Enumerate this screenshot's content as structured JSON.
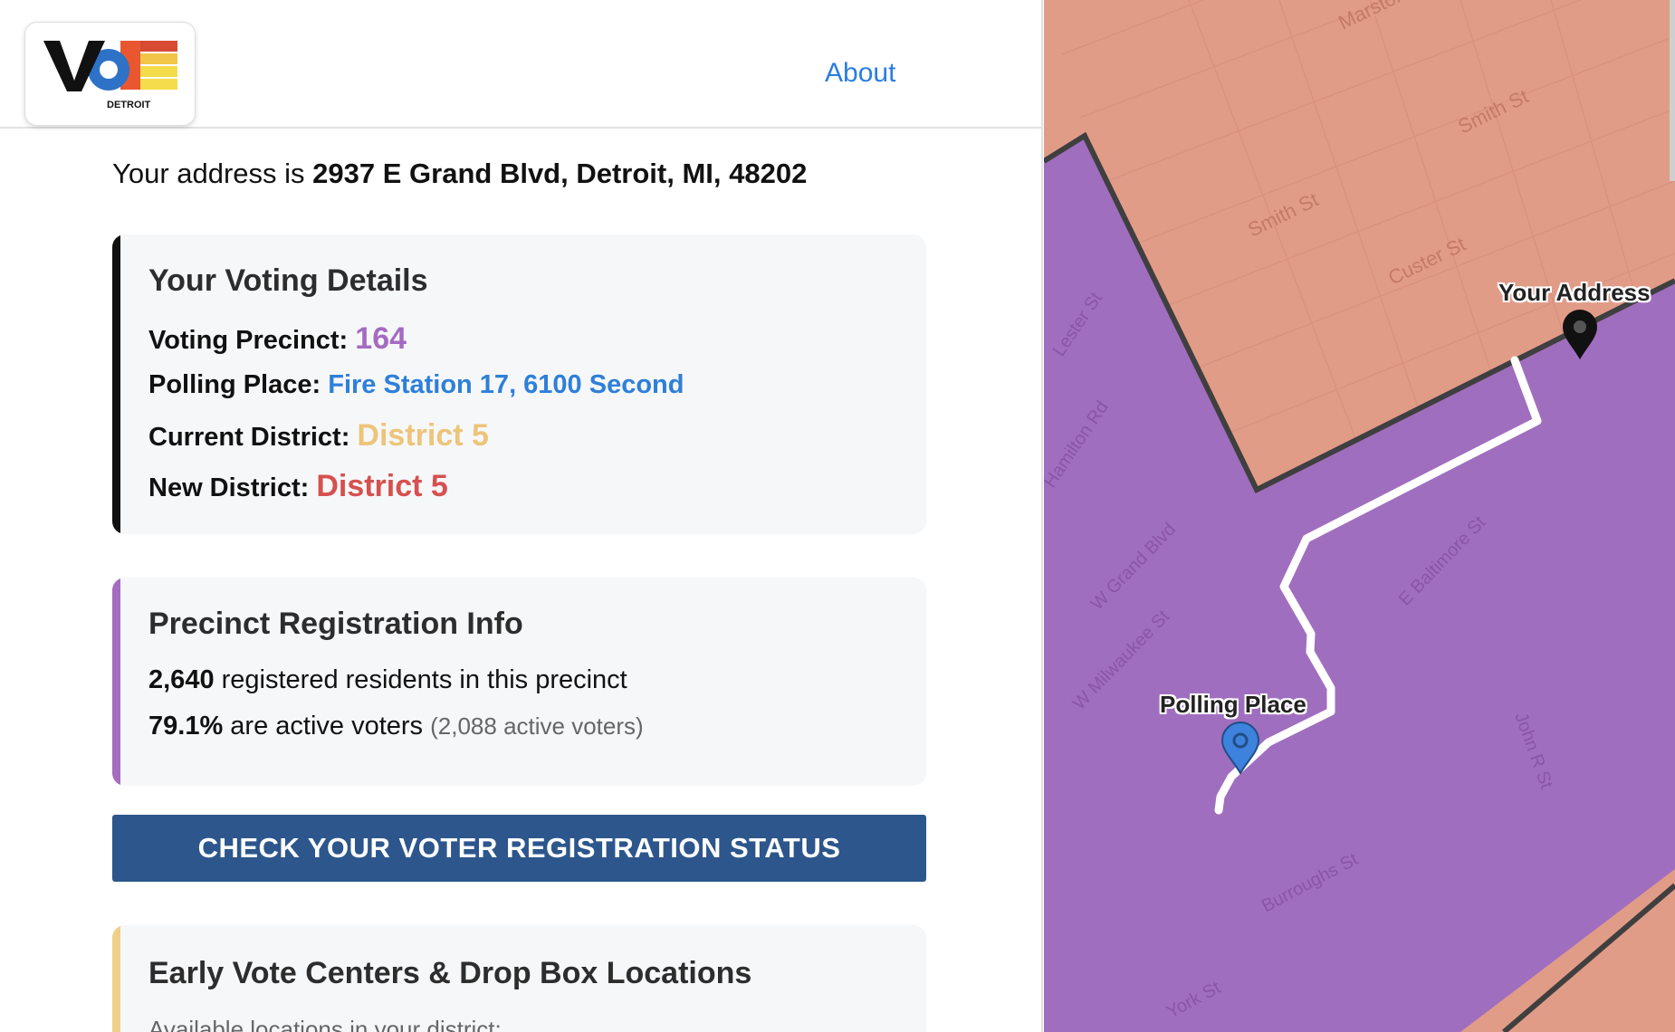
{
  "header": {
    "logo": {
      "main": "VOTE",
      "sub": "DETROIT"
    },
    "about_label": "About"
  },
  "address": {
    "prefix": "Your address is",
    "value": "2937 E Grand Blvd, Detroit, MI, 48202"
  },
  "voting_details": {
    "title": "Your Voting Details",
    "precinct_label": "Voting Precinct:",
    "precinct_value": "164",
    "polling_label": "Polling Place:",
    "polling_value": "Fire Station 17, 6100 Second",
    "current_label": "Current District:",
    "current_value": "District 5",
    "new_label": "New District:",
    "new_value": "District 5"
  },
  "precinct_info": {
    "title": "Precinct Registration Info",
    "registered_count": "2,640",
    "registered_text": "registered residents in this precinct",
    "active_pct": "79.1%",
    "active_text": "are active voters",
    "active_count_text": "(2,088 active voters)"
  },
  "check_button": {
    "label": "CHECK YOUR VOTER REGISTRATION STATUS"
  },
  "early_vote": {
    "title": "Early Vote Centers & Drop Box Locations",
    "subtitle": "Available locations in your district:"
  },
  "map": {
    "streets": {
      "marston": "Marston",
      "smith_1": "Smith St",
      "smith_2": "Smith St",
      "custer": "Custer St",
      "hamilton": "Hamilton Rd",
      "e_grand": "W Grand Blvd",
      "milwaukee": "W Milwaukee St",
      "baltimore": "E Baltimore St",
      "burroughs": "Burroughs St",
      "york": "York St",
      "john_r": "John R St",
      "lester": "Lester St"
    },
    "pins": {
      "your_address": "Your Address",
      "polling_place": "Polling Place"
    },
    "colors": {
      "current_district": "#e19c88",
      "new_district": "#a06ebf",
      "route": "#ffffff",
      "polling_pin": "#3d82dc",
      "address_pin": "#111111"
    }
  }
}
